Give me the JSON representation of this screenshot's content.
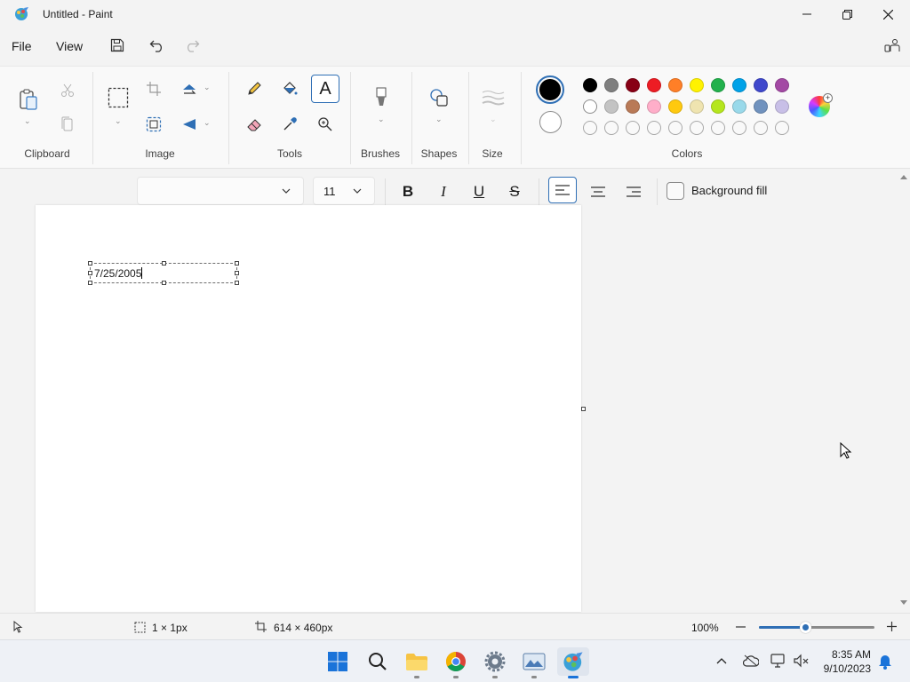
{
  "window": {
    "title": "Untitled - Paint"
  },
  "menu": {
    "file": "File",
    "view": "View"
  },
  "ribbon": {
    "groups": {
      "clipboard": "Clipboard",
      "image": "Image",
      "tools": "Tools",
      "brushes": "Brushes",
      "shapes": "Shapes",
      "size": "Size",
      "colors": "Colors"
    },
    "primary_color": "#000000",
    "secondary_color": "#ffffff",
    "palette": [
      "#000000",
      "#7f7f7f",
      "#880015",
      "#ed1c24",
      "#ff7f27",
      "#fff200",
      "#22b14c",
      "#00a2e8",
      "#3f48cc",
      "#a349a4",
      "#ffffff",
      "#c3c3c3",
      "#b97a57",
      "#ffaec9",
      "#ffc90e",
      "#efe4b0",
      "#b5e61d",
      "#99d9ea",
      "#7092be",
      "#c8bfe7"
    ]
  },
  "textbar": {
    "font_family": "",
    "font_size": "11",
    "bold_glyph": "B",
    "italic_glyph": "I",
    "underline_glyph": "U",
    "strike_glyph": "S",
    "background_fill": "Background fill"
  },
  "canvas": {
    "text": "7/25/2005"
  },
  "status": {
    "selection": "1 × 1px",
    "canvas_size": "614 × 460px",
    "zoom": "100%",
    "zoom_level_fraction": 0.4
  },
  "taskbar": {
    "time": "8:35 AM",
    "date": "9/10/2023"
  }
}
